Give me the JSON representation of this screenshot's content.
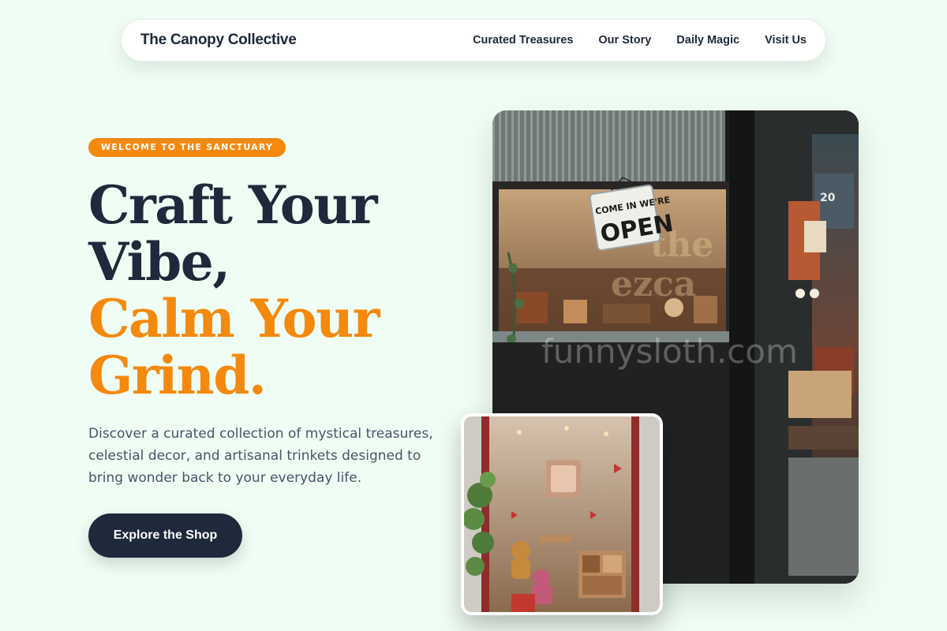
{
  "nav": {
    "brand": "The Canopy Collective",
    "links": [
      "Curated Treasures",
      "Our Story",
      "Daily Magic",
      "Visit Us"
    ]
  },
  "hero": {
    "badge": "WELCOME TO THE SANCTUARY",
    "headline_line1": "Craft Your",
    "headline_line2": "Vibe,",
    "headline_line3": "Calm Your",
    "headline_line4": "Grind.",
    "description": "Discover a curated collection of mystical treasures, celestial decor, and artisanal trinkets designed to bring wonder back to your everyday life.",
    "cta_label": "Explore the Shop"
  },
  "images": {
    "main_sign_line1": "COME IN WE'RE",
    "main_sign_line2": "OPEN",
    "watermark": "funnysloth.com"
  },
  "colors": {
    "background": "#f0fdf4",
    "accent": "#f5890e",
    "dark": "#1e293b",
    "body_text": "#475569"
  }
}
